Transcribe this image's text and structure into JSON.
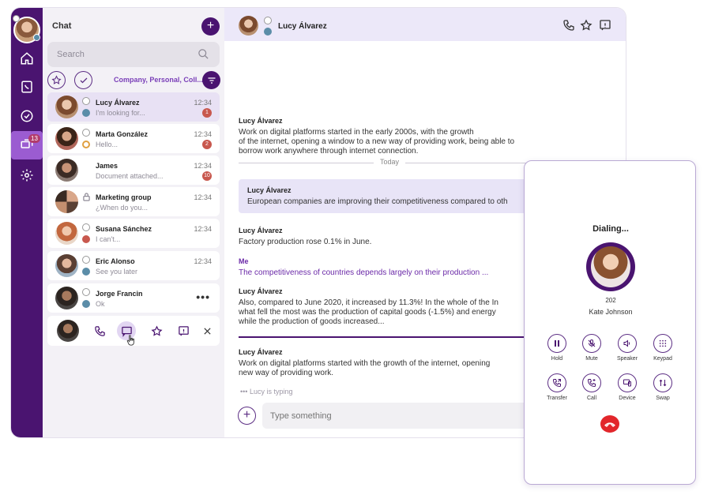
{
  "rail": {
    "nav_badge": "13",
    "items": [
      "home-icon",
      "phonebook-icon",
      "presence-icon",
      "chat-icon",
      "settings-icon"
    ]
  },
  "chat_list": {
    "title": "Chat",
    "search_placeholder": "Search",
    "filter_label": "Company, Personal, Coll...",
    "rows": [
      {
        "name": "Lucy Álvarez",
        "preview": "I'm looking for...",
        "time": "12:34",
        "count": "1"
      },
      {
        "name": "Marta González",
        "preview": "Hello...",
        "time": "12:34",
        "count": "2"
      },
      {
        "name": "James",
        "preview": "Document attached...",
        "time": "12:34",
        "count": "10"
      },
      {
        "name": "Marketing group",
        "preview": "¿When do you...",
        "time": "12:34",
        "count": ""
      },
      {
        "name": "Susana Sánchez",
        "preview": "I can't...",
        "time": "12:34",
        "count": ""
      },
      {
        "name": "Eric Alonso",
        "preview": "See you later",
        "time": "12:34",
        "count": ""
      },
      {
        "name": "Jorge Francin",
        "preview": "Ok",
        "time": "",
        "count": ""
      }
    ]
  },
  "conversation": {
    "contact": "Lucy Álvarez",
    "divider": "Today",
    "messages": [
      {
        "who": "Lucy Álvarez",
        "lines": [
          "Work on digital platforms started in the early 2000s, with the growth",
          "of the internet, opening a window to a new way of providing work, being able to",
          "borrow work anywhere through internet connection."
        ]
      },
      {
        "who": "Lucy Álvarez",
        "lines": [
          "European companies are improving their competitiveness compared to oth"
        ]
      },
      {
        "who": "Lucy Álvarez",
        "lines": [
          "Factory production rose 0.1% in June."
        ]
      },
      {
        "who": "Me",
        "lines": [
          "The competitiveness of countries depends largely on their production ..."
        ]
      },
      {
        "who": "Lucy Álvarez",
        "lines": [
          "Also, compared to June 2020, it increased by 11.3%! In the whole of the In",
          "what fell the most was the production of capital goods (-1.5%) and energy",
          "while the production of goods increased..."
        ]
      },
      {
        "who": "Lucy Álvarez",
        "lines": [
          "Work on digital platforms started with the growth of the internet, opening",
          "new way of providing work."
        ]
      }
    ],
    "typing": "••• Lucy is typing",
    "input_placeholder": "Type something"
  },
  "dialer": {
    "status": "Dialing...",
    "extension": "202",
    "name": "Kate Johnson",
    "controls": [
      "Hold",
      "Mute",
      "Speaker",
      "Keypad",
      "Transfer",
      "Call",
      "Device",
      "Swap"
    ],
    "hangup_color": "#e2262b"
  },
  "colors": {
    "brand": "#4a1470",
    "accent": "#9b5cd1",
    "highlight": "#e8e4f7"
  }
}
